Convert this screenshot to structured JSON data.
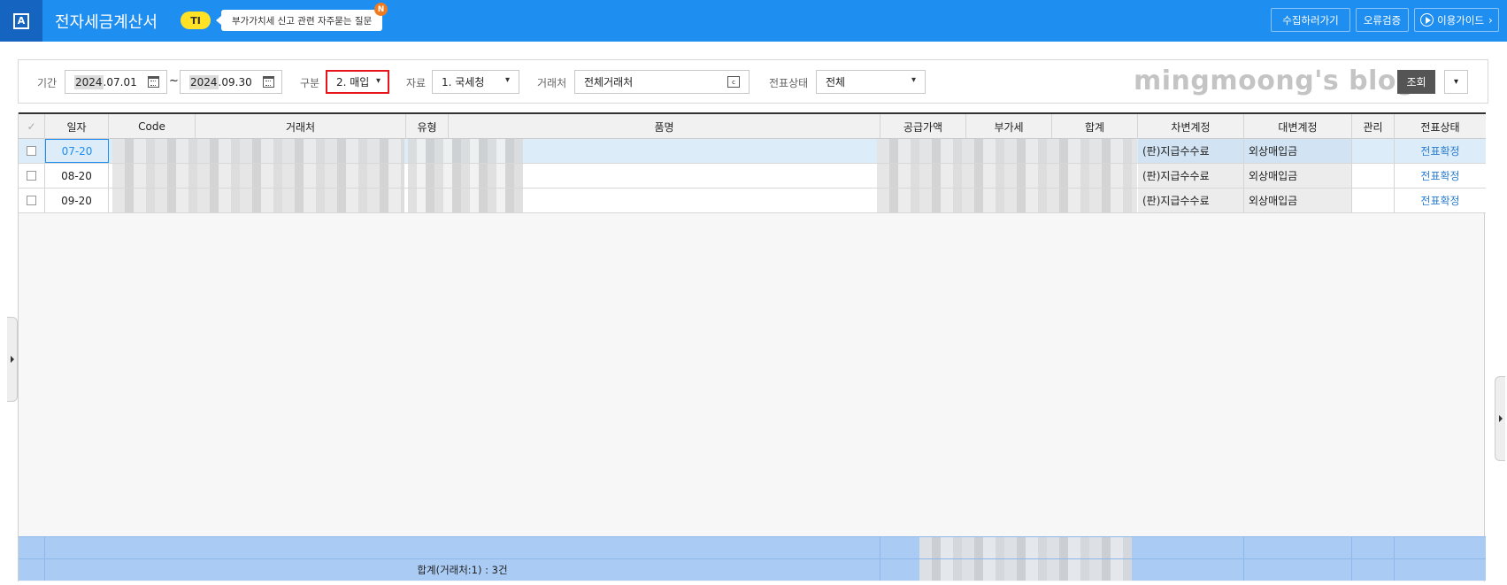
{
  "app": {
    "logo_letter": "A",
    "title": "전자세금계산서",
    "badge": "TI",
    "notice": "부가가치세 신고 관련 자주묻는 질문",
    "new_badge": "N"
  },
  "top_buttons": {
    "collect": "수집하러가기",
    "error_check": "오류검증",
    "guide": "이용가이드"
  },
  "filter": {
    "period_label": "기간",
    "start_year": "2024",
    "start_rest": ".07.01",
    "end_year": "2024",
    "end_rest": ".09.30",
    "tilde": "~",
    "type_label": "구분",
    "type_value": "2. 매입",
    "source_label": "자료",
    "source_value": "1. 국세청",
    "vendor_label": "거래처",
    "vendor_value": "전체거래처",
    "status_label": "전표상태",
    "status_value": "전체",
    "search_button": "조회"
  },
  "watermark": "mingmoong's blog",
  "grid": {
    "headers": {
      "date": "일자",
      "code": "Code",
      "vendor": "거래처",
      "type": "유형",
      "item": "품명",
      "supply": "공급가액",
      "vat": "부가세",
      "total": "합계",
      "debit": "차변계정",
      "credit": "대변계정",
      "manage": "관리",
      "status": "전표상태"
    },
    "rows": [
      {
        "date": "07-20",
        "debit": "(판)지급수수료",
        "credit": "외상매입금",
        "status": "전표확정"
      },
      {
        "date": "08-20",
        "debit": "(판)지급수수료",
        "credit": "외상매입금",
        "status": "전표확정"
      },
      {
        "date": "09-20",
        "debit": "(판)지급수수료",
        "credit": "외상매입금",
        "status": "전표확정"
      }
    ],
    "summary": "합계(거래처:1) : 3건"
  },
  "colors": {
    "topbar": "#1f8ef1",
    "logo_bg": "#1565c0",
    "highlight": "#e8141c",
    "summary_bg": "#a9cbf4",
    "link": "#2b7ed0"
  }
}
